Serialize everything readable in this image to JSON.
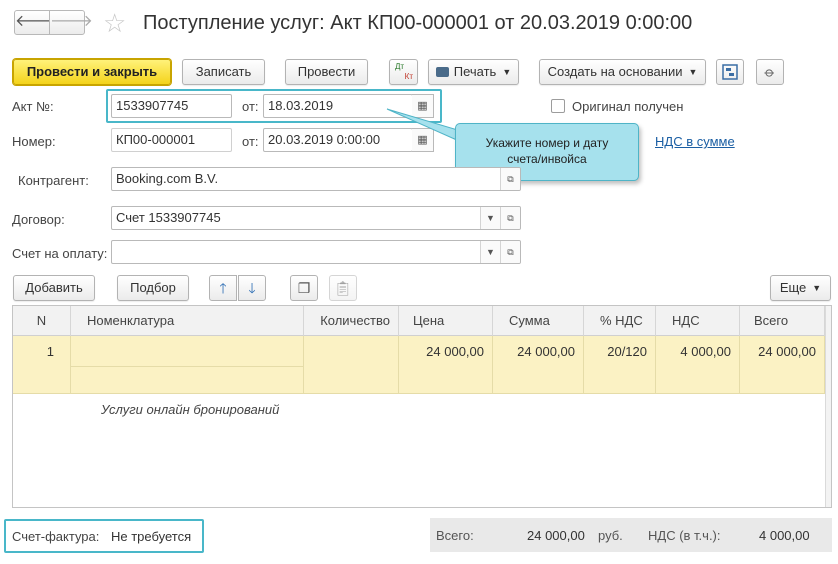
{
  "window": {
    "title": "Поступление услуг: Акт КП00-000001 от 20.03.2019 0:00:00",
    "back_glyph": "🡐",
    "forward_glyph": "🡒",
    "star_glyph": "☆"
  },
  "toolbar": {
    "post_close": "Провести и закрыть",
    "save": "Записать",
    "post": "Провести",
    "dtkt_icon": "dt-kt-icon",
    "dt": "Дт",
    "kt": "Кт",
    "print": "Печать",
    "create_based": "Создать на основании"
  },
  "form": {
    "act_label": "Акт №:",
    "act_number": "1533907745",
    "from_label": "от:",
    "act_date": "18.03.2019",
    "original_label": "Оригинал получен",
    "original_checked": false,
    "number_label": "Номер:",
    "number": "КП00-000001",
    "from_label2": "от:",
    "number_date": "20.03.2019  0:00:00",
    "vat_link": "НДС в сумме",
    "counterparty_label": "Контрагент:",
    "counterparty": "Booking.com B.V.",
    "contract_label": "Договор:",
    "contract": "Счет 1533907745",
    "invoice_label": "Счет на оплату:",
    "invoice": ""
  },
  "callout": {
    "line1": "Укажите номер и дату",
    "line2": "счета/инвойса"
  },
  "table_toolbar": {
    "add": "Добавить",
    "pick": "Подбор",
    "more": "Еще"
  },
  "table": {
    "columns": [
      "N",
      "Номенклатура",
      "Количество",
      "Цена",
      "Сумма",
      "% НДС",
      "НДС",
      "Всего"
    ],
    "rows": [
      {
        "n": "1",
        "item": "",
        "item_desc": "Услуги онлайн бронирований",
        "qty": "",
        "price": "24 000,00",
        "sum": "24 000,00",
        "vat_rate": "20/120",
        "vat": "4 000,00",
        "total": "24 000,00"
      }
    ]
  },
  "footer": {
    "invoice_label": "Счет-фактура:",
    "invoice_value": "Не требуется",
    "total_label": "Всего:",
    "total_value": "24 000,00",
    "currency": "руб.",
    "vat_label": "НДС (в т.ч.):",
    "vat_value": "4 000,00"
  },
  "colors": {
    "primary_button": "#f4d31b",
    "highlight": "#49b7c9",
    "callout_bg": "#a6e1ed",
    "selected_row": "#fbf2c4",
    "link": "#1a5ea3"
  }
}
